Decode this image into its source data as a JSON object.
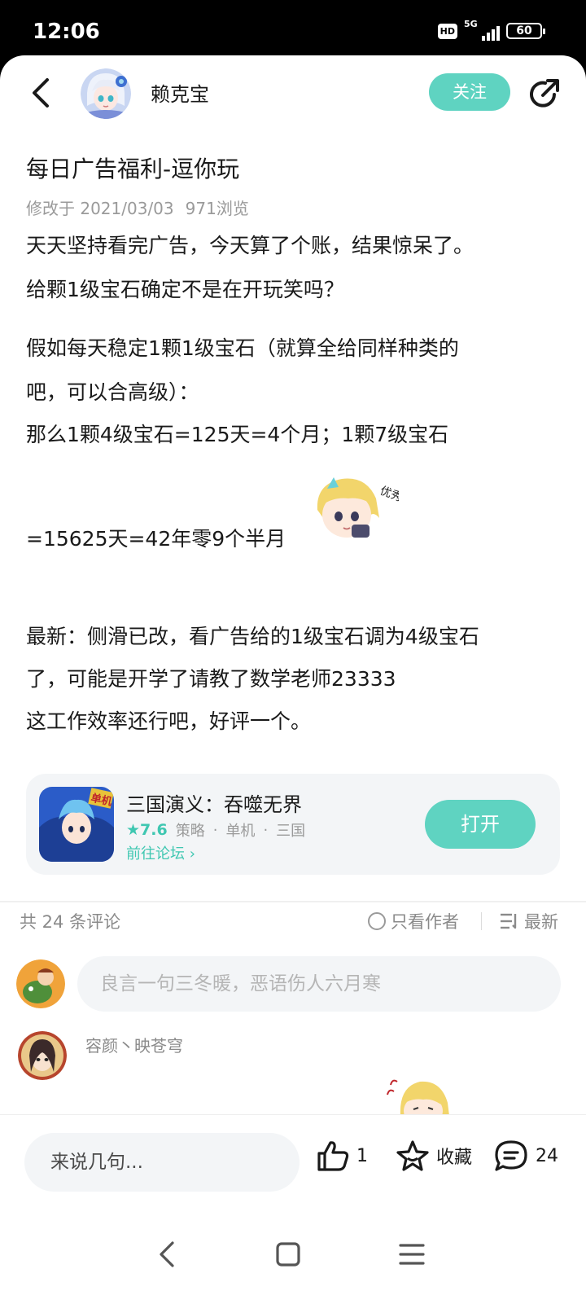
{
  "status_bar": {
    "time": "12:06",
    "hd": "HD",
    "network": "5G",
    "battery": "60"
  },
  "header": {
    "author_name": "赖克宝",
    "follow_label": "关注"
  },
  "post": {
    "title": "每日广告福利-逗你玩",
    "modified": "修改于 2021/03/03",
    "views": "971浏览",
    "lines": [
      "天天坚持看完广告，今天算了个账，结果惊呆了。",
      "给颗1级宝石确定不是在开玩笑吗？",
      "假如每天稳定1颗1级宝石（就算全给同样种类的",
      "吧，可以合高级）：",
      "那么1颗4级宝石=125天=4个月；1颗7级宝石",
      "=15625天=42年零9个半月",
      "最新：侧滑已改，看广告给的1级宝石调为4级宝石",
      "了，可能是开学了请教了数学老师23333",
      "这工作效率还行吧，好评一个。"
    ],
    "sticker_text": "优秀"
  },
  "game_card": {
    "name": "三国演义：吞噬无界",
    "rating": "★7.6",
    "tags": [
      "策略",
      "·",
      "单机",
      "·",
      "三国"
    ],
    "forum_link": "前往论坛 ›",
    "open_label": "打开",
    "icon_badge": "单机"
  },
  "comments": {
    "count_label": "共 24 条评论",
    "author_only_label": "只看作者",
    "sort_label": "最新",
    "input_placeholder": "良言一句三冬暖，恶语伤人六月寒",
    "first_commenter": "容颜丶映苍穹"
  },
  "bottom_bar": {
    "say_placeholder": "来说几句...",
    "like_count": "1",
    "collect_label": "收藏",
    "comment_count": "24"
  },
  "colors": {
    "accent": "#5fd3c1",
    "accent_text": "#3fc7b1"
  }
}
